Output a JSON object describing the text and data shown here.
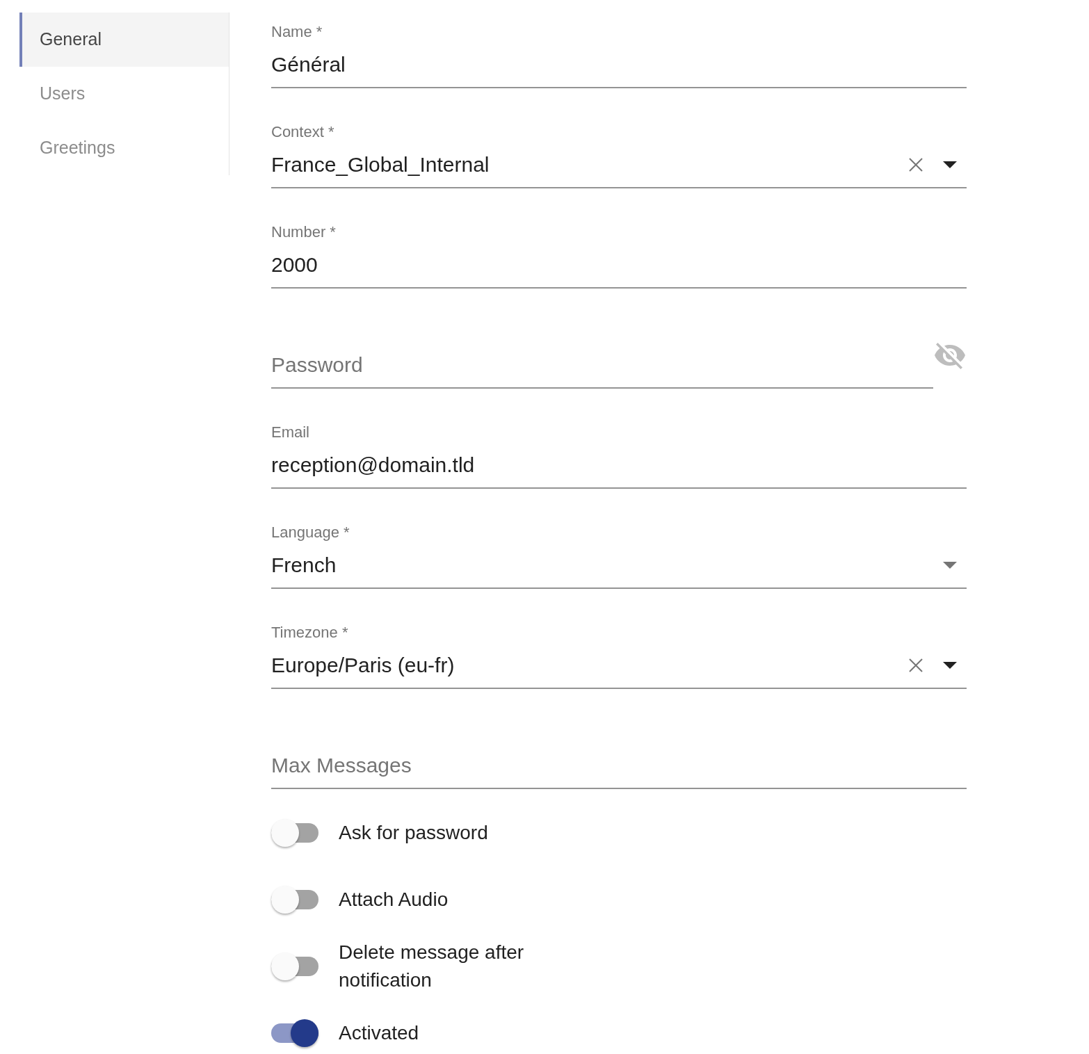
{
  "sidebar": {
    "items": [
      {
        "label": "General",
        "selected": true
      },
      {
        "label": "Users",
        "selected": false
      },
      {
        "label": "Greetings",
        "selected": false
      }
    ]
  },
  "fields": [
    {
      "kind": "text",
      "label": "Name *",
      "value": "Général"
    },
    {
      "kind": "autocomplete",
      "label": "Context *",
      "value": "France_Global_Internal"
    },
    {
      "kind": "text",
      "label": "Number *",
      "value": "2000"
    },
    {
      "kind": "password",
      "placeholder": "Password"
    },
    {
      "kind": "text",
      "label": "Email",
      "value": "reception@domain.tld"
    },
    {
      "kind": "select",
      "label": "Language *",
      "value": "French"
    },
    {
      "kind": "autocomplete",
      "label": "Timezone *",
      "value": "Europe/Paris (eu-fr)"
    },
    {
      "kind": "text",
      "placeholder": "Max Messages"
    }
  ],
  "switches": [
    {
      "label": "Ask for password",
      "on": false
    },
    {
      "label": "Attach Audio",
      "on": false
    },
    {
      "label": "Delete message after notification",
      "on": false
    },
    {
      "label": "Activated",
      "on": true
    }
  ]
}
